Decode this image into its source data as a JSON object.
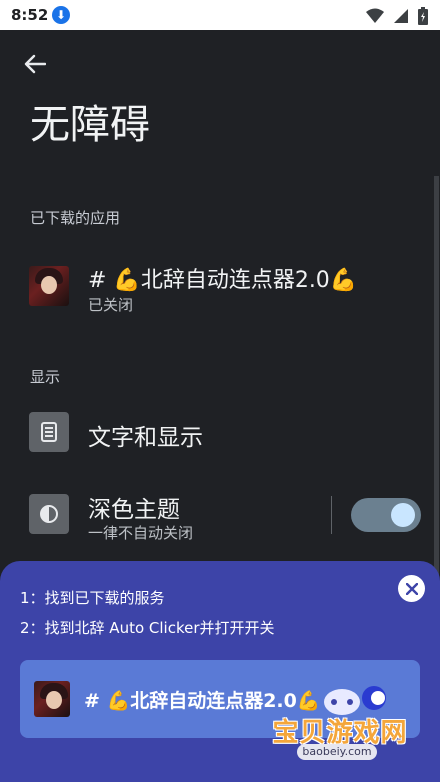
{
  "status_bar": {
    "time": "8:52",
    "icons": [
      "download-badge-icon",
      "wifi-icon",
      "signal-icon",
      "battery-icon"
    ]
  },
  "header": {
    "title": "无障碍"
  },
  "sections": {
    "downloaded_apps": "已下载的应用",
    "display": "显示"
  },
  "downloaded_app": {
    "name": "# 💪北辞自动连点器2.0💪",
    "status": "已关闭"
  },
  "display_prefs": {
    "text_display": "文字和显示",
    "dark_theme": {
      "title": "深色主题",
      "subtitle": "一律不自动关闭",
      "enabled": true
    }
  },
  "guide": {
    "step1": "1：找到已下载的服务",
    "step2": "2：找到北辞 Auto Clicker并打开开关",
    "card_title": "# 💪北辞自动连点器2.0💪"
  },
  "watermark": {
    "text": "宝贝游戏网",
    "url": "baobeiy.com"
  },
  "colors": {
    "background": "#1f2125",
    "guide_panel": "#3d44a8",
    "guide_card": "#5a7ad6",
    "toggle_track": "#6b8090",
    "toggle_knob": "#c9e6ff"
  }
}
